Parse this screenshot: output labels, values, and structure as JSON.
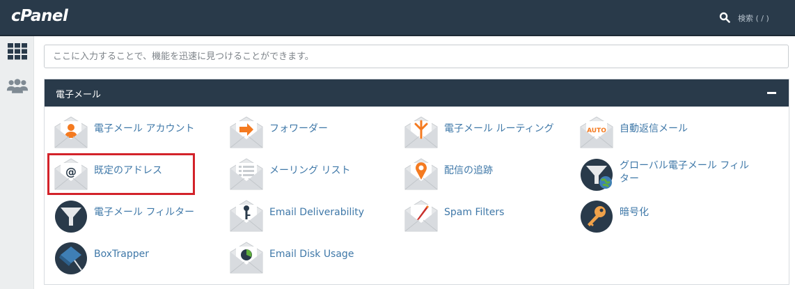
{
  "app": {
    "logo": "cPanel",
    "search_label": "検索 ( / )"
  },
  "sidebar": {
    "items": [
      {
        "name": "apps-grid-icon"
      },
      {
        "name": "users-icon"
      }
    ]
  },
  "search": {
    "placeholder": "ここに入力することで、機能を迅速に見つけることができます。"
  },
  "panel": {
    "title": "電子メール",
    "items": [
      {
        "label": "電子メール アカウント",
        "icon": "email-accounts-icon"
      },
      {
        "label": "フォワーダー",
        "icon": "forwarders-icon"
      },
      {
        "label": "電子メール ルーティング",
        "icon": "email-routing-icon"
      },
      {
        "label": "自動返信メール",
        "icon": "autoresponders-icon",
        "icon_text": "AUTO"
      },
      {
        "label": "既定のアドレス",
        "icon": "default-address-icon",
        "icon_text": "@"
      },
      {
        "label": "メーリング リスト",
        "icon": "mailing-lists-icon"
      },
      {
        "label": "配信の追跡",
        "icon": "track-delivery-icon"
      },
      {
        "label": "グローバル電子メール フィルター",
        "icon": "global-email-filters-icon"
      },
      {
        "label": "電子メール フィルター",
        "icon": "email-filters-icon"
      },
      {
        "label": "Email Deliverability",
        "icon": "email-deliverability-icon"
      },
      {
        "label": "Spam Filters",
        "icon": "spam-filters-icon"
      },
      {
        "label": "暗号化",
        "icon": "encryption-icon"
      },
      {
        "label": "BoxTrapper",
        "icon": "boxtrapper-icon"
      },
      {
        "label": "Email Disk Usage",
        "icon": "email-disk-usage-icon"
      }
    ]
  },
  "colors": {
    "header_bg": "#293a4a",
    "link": "#3f78a8",
    "accent_orange": "#f47a20",
    "highlight": "#d3222a"
  }
}
